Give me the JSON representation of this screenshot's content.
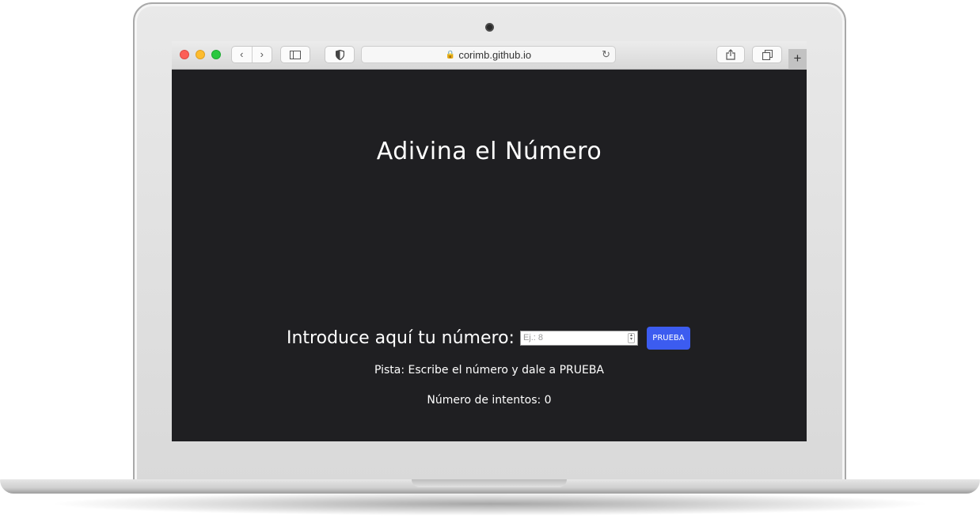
{
  "browser": {
    "url": "corimb.github.io",
    "icons": {
      "back": "chevron-left-icon",
      "forward": "chevron-right-icon",
      "sidebar": "sidebar-icon",
      "privacy": "shield-icon",
      "lock": "lock-icon",
      "reload": "reload-icon",
      "share": "share-icon",
      "tabs": "tabs-icon",
      "new_tab": "plus-icon"
    }
  },
  "page": {
    "title": "Adivina el Número",
    "label": "Introduce aquí tu número:",
    "input_placeholder": "Ej.: 8",
    "submit_label": "PRUEBA",
    "hint": "Pista: Escribe el número y dale a PRUEBA",
    "attempts": "Número de intentos: 0"
  },
  "colors": {
    "page_background": "#1f1f22",
    "text": "#ffffff",
    "button": "#3c5cf0"
  }
}
